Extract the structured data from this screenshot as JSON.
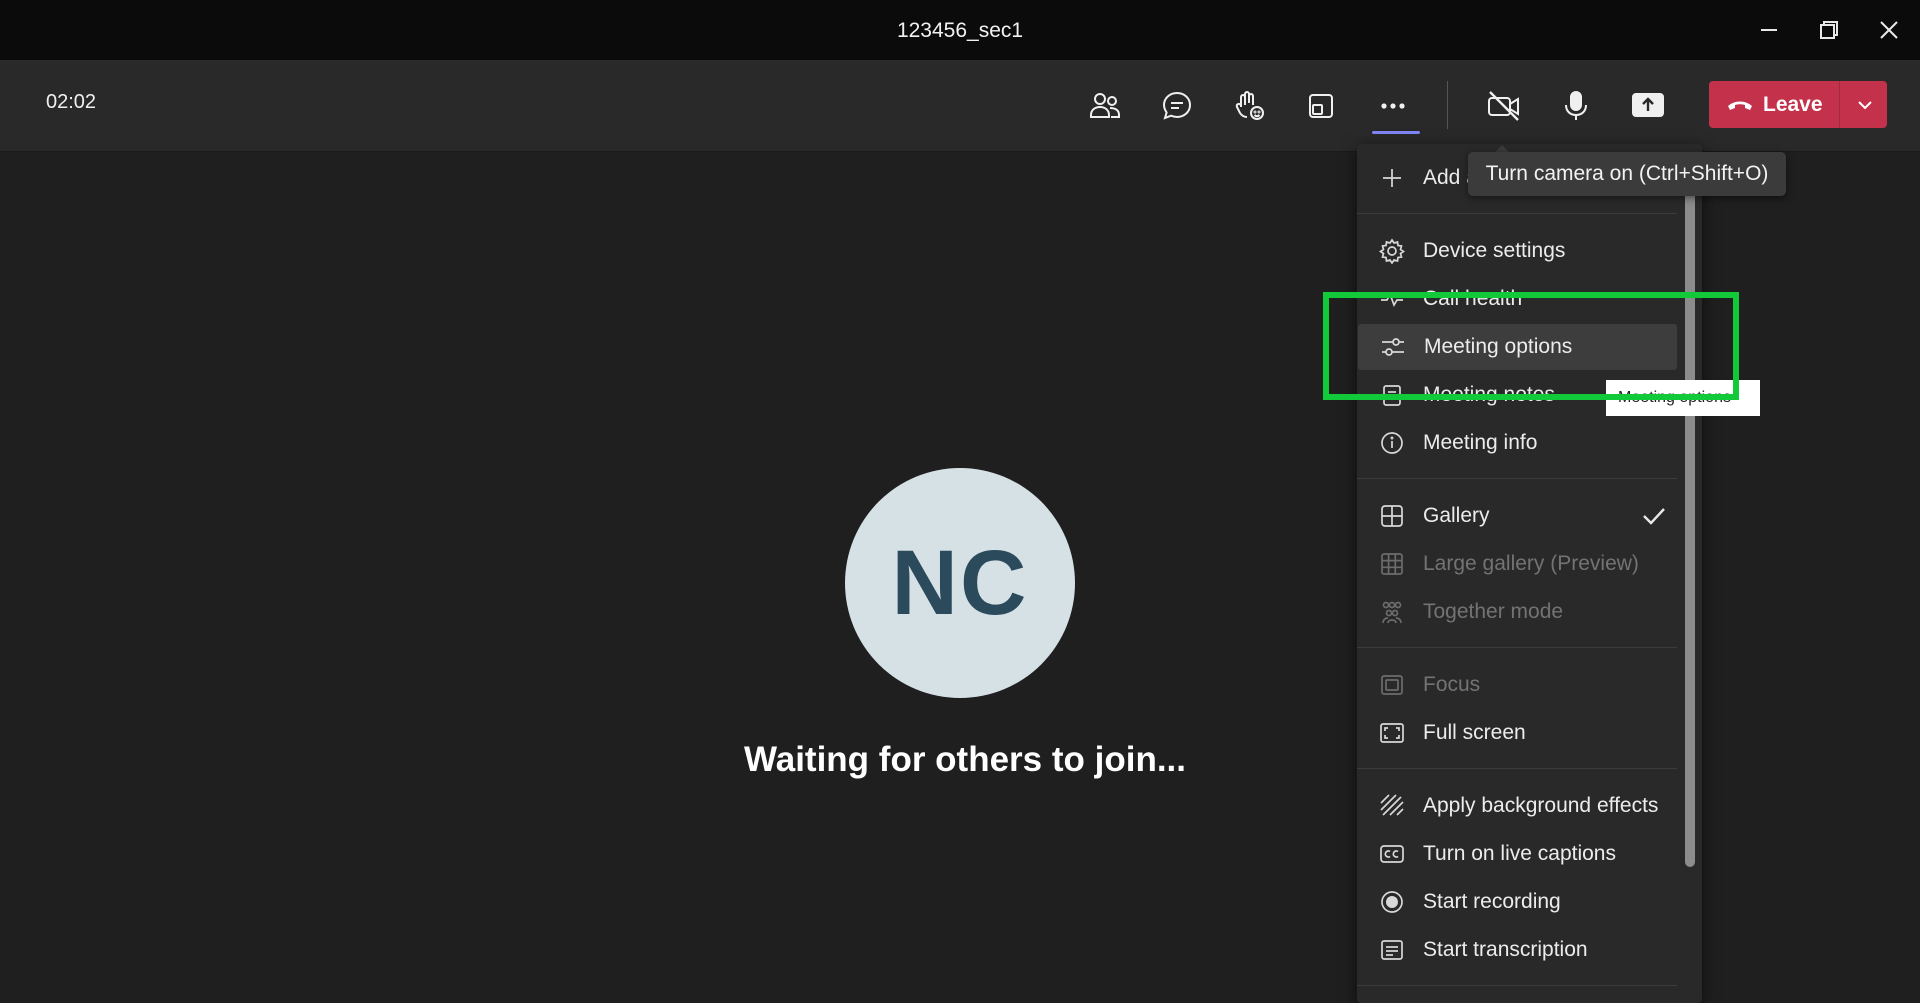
{
  "window": {
    "title": "123456_sec1"
  },
  "toolbar": {
    "timer": "02:02",
    "leave_label": "Leave"
  },
  "stage": {
    "avatar_initials": "NC",
    "waiting_text": "Waiting for others to join..."
  },
  "tooltip": {
    "text": "Turn camera on (Ctrl+Shift+O)"
  },
  "hover_tooltip": {
    "text": "Meeting options"
  },
  "menu": {
    "add": "Add a",
    "device_settings": "Device settings",
    "call_health": "Call health",
    "meeting_options": "Meeting options",
    "meeting_notes": "Meeting notes",
    "meeting_info": "Meeting info",
    "gallery": "Gallery",
    "large_gallery": "Large gallery (Preview)",
    "together_mode": "Together mode",
    "focus": "Focus",
    "full_screen": "Full screen",
    "background_effects": "Apply background effects",
    "live_captions": "Turn on live captions",
    "start_recording": "Start recording",
    "start_transcription": "Start transcription"
  },
  "colors": {
    "leave": "#c4314b",
    "accent": "#7f85f5",
    "highlight": "#12c93a"
  }
}
